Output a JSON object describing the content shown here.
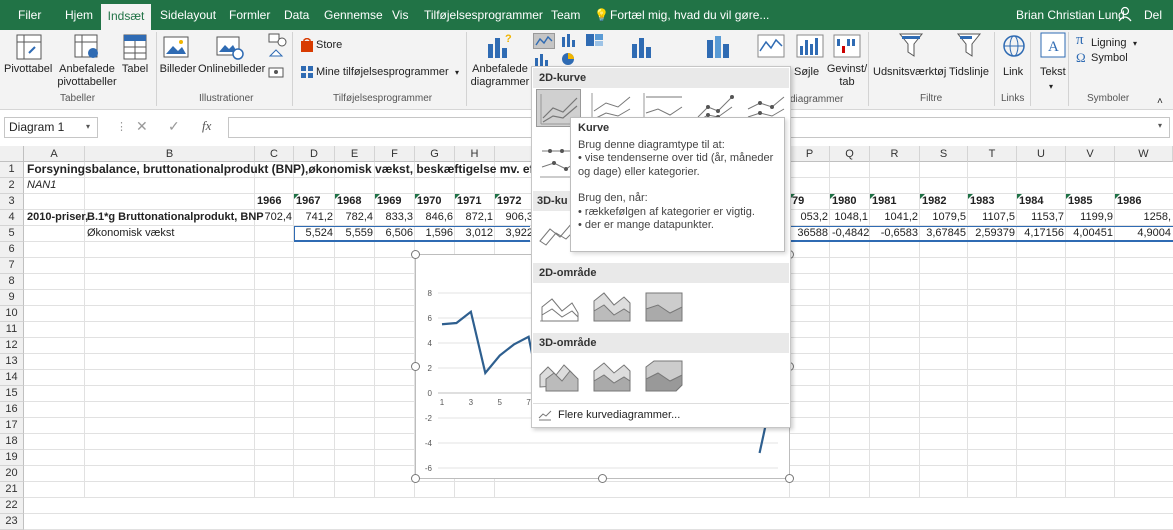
{
  "menu": {
    "tabs": [
      "Filer",
      "Hjem",
      "Indsæt",
      "Sidelayout",
      "Formler",
      "Data",
      "Gennemse",
      "Vis",
      "Tilføjelsesprogrammer",
      "Team"
    ],
    "active": "Indsæt",
    "tell_me": "Fortæl mig, hvad du vil gøre...",
    "user": "Brian Christian Lund",
    "share": "Del"
  },
  "ribbon": {
    "pivottabel": "Pivottabel",
    "anbefalede_pivot": "Anbefalede\npivottabeller",
    "tabel": "Tabel",
    "group_tabeller": "Tabeller",
    "billeder": "Billeder",
    "onlinebilleder": "Onlinebilleder",
    "group_illustrationer": "Illustrationer",
    "store": "Store",
    "mine_tilf": "Mine tilføjelsesprogrammer",
    "group_tilf": "Tilføjelsesprogrammer",
    "anbefalede_diag": "Anbefalede\ndiagrammer",
    "group_diag_partial": "diagrammer",
    "sojle": "Søjle",
    "gevinst": "Gevinst/\ntab",
    "group_minidiag_partial": "Minidiagrammer",
    "udsnit": "Udsnitsværktøj",
    "tidslinje": "Tidslinje",
    "group_filtre": "Filtre",
    "link": "Link",
    "group_links": "Links",
    "tekst": "Tekst",
    "ligning": "Ligning",
    "symbol": "Symbol",
    "group_symboler": "Symboler"
  },
  "formula_bar": {
    "name_box": "Diagram 1",
    "fx": "fx",
    "value": ""
  },
  "sheet": {
    "columns": [
      "A",
      "B",
      "C",
      "D",
      "E",
      "F",
      "G",
      "H",
      "I",
      "P",
      "Q",
      "R",
      "S",
      "T",
      "U",
      "V",
      "W"
    ],
    "rows": [
      "1",
      "2",
      "3",
      "4",
      "5",
      "6",
      "7",
      "8",
      "9",
      "10",
      "11",
      "12",
      "13",
      "14",
      "15",
      "16",
      "17",
      "18",
      "19",
      "20",
      "21",
      "22",
      "23"
    ],
    "title": "Forsyningsbalance, bruttonationalprodukt (BNP),økonomisk vækst, beskæftigelse mv. efter",
    "nan1": "NAN1",
    "years_left": [
      "1966",
      "1967",
      "1968",
      "1969",
      "1970",
      "1971",
      "1972"
    ],
    "years_right": [
      "79",
      "1980",
      "1981",
      "1982",
      "1983",
      "1984",
      "1985",
      "1986"
    ],
    "row4_a": "2010-priser,",
    "row4_b": "B.1*g Bruttonationalprodukt, BNP",
    "row4_left": [
      "702,4",
      "741,2",
      "782,4",
      "833,3",
      "846,6",
      "872,1",
      "906,3"
    ],
    "row4_right": [
      "053,2",
      "1048,1",
      "1041,2",
      "1079,5",
      "1107,5",
      "1153,7",
      "1199,9",
      "1258,"
    ],
    "row5_b": "Økonomisk vækst",
    "row5_left": [
      "5,524",
      "5,559",
      "6,506",
      "1,596",
      "3,012",
      "3,922"
    ],
    "row5_right": [
      "36588",
      "-0,4842",
      "-0,6583",
      "3,67845",
      "2,59379",
      "4,17156",
      "4,00451",
      "4,9004"
    ]
  },
  "chart_data": {
    "type": "line",
    "title": "",
    "y_ticks": [
      "8",
      "6",
      "4",
      "2",
      "0",
      "-2",
      "-4",
      "-6"
    ],
    "ylim": [
      -6,
      8
    ],
    "x_ticks": [
      "1",
      "3",
      "5",
      "7",
      "9",
      "1"
    ],
    "series": [
      {
        "color": "#2e5f8f",
        "values": [
          5.5,
          5.6,
          6.5,
          1.6,
          3.0,
          3.9,
          4.5,
          -1.2,
          -1.5,
          4.5,
          5.0,
          -0.5,
          -0.6,
          null,
          null,
          null,
          null,
          null,
          null,
          null,
          null,
          null,
          -4.8,
          0.5
        ]
      }
    ]
  },
  "dropdown": {
    "section_2d_kurve": "2D-kurve",
    "section_3d_kurve": "3D-ku",
    "section_2d_omrade": "2D-område",
    "section_3d_omrade": "3D-område",
    "more": "Flere kurvediagrammer..."
  },
  "tooltip": {
    "title": "Kurve",
    "line1": "Brug denne diagramtype til at:",
    "line2": "• vise tendenserne over tid (år, måneder",
    "line3": "og dage) eller kategorier.",
    "line4": "Brug den, når:",
    "line5": "• rækkefølgen af kategorier er vigtig.",
    "line6": "• der er mange datapunkter."
  }
}
